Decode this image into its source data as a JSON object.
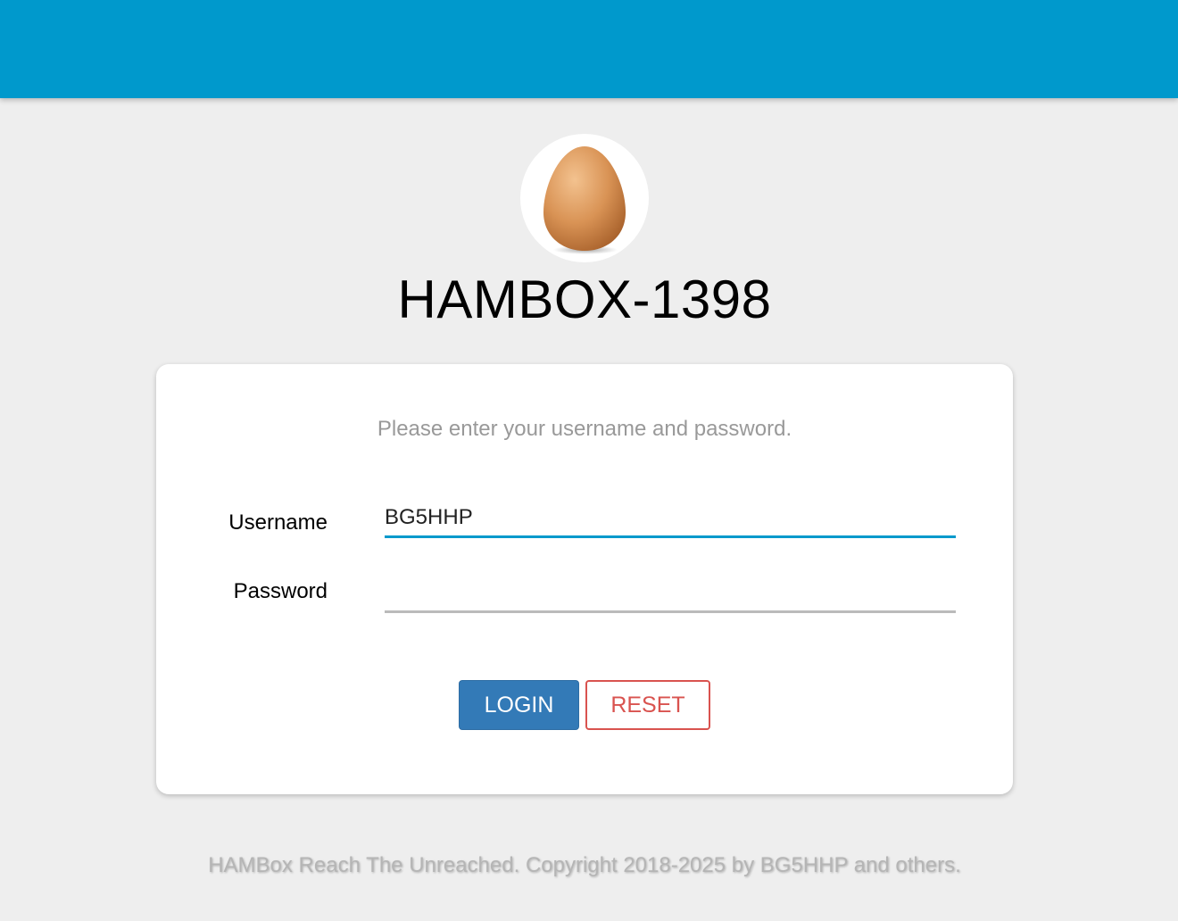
{
  "header": {
    "bar_color": "#0099cc"
  },
  "avatar": {
    "icon": "egg-icon"
  },
  "device": {
    "hostname": "HAMBOX-1398"
  },
  "login": {
    "prompt": "Please enter your username and password.",
    "username_label": "Username",
    "username_value": "BG5HHP",
    "password_label": "Password",
    "password_value": "",
    "login_button": "LOGIN",
    "reset_button": "RESET"
  },
  "colors": {
    "accent": "#0099cc",
    "primary_button": "#337ab7",
    "reset_button": "#d9534f",
    "background": "#eeeeee"
  },
  "footer": {
    "text": "HAMBox Reach The Unreached. Copyright 2018-2025 by BG5HHP and others."
  }
}
